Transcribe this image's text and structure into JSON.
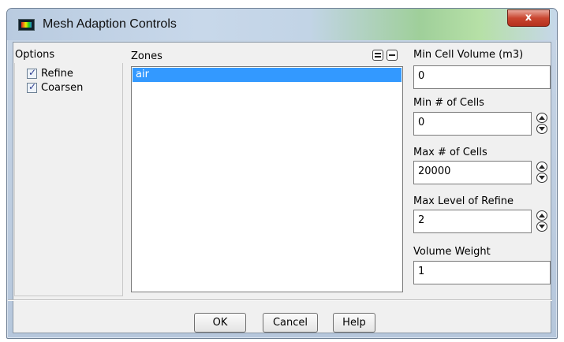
{
  "window": {
    "title": "Mesh Adaption Controls",
    "close_label": "x"
  },
  "options": {
    "label": "Options",
    "items": [
      {
        "label": "Refine",
        "checked": true
      },
      {
        "label": "Coarsen",
        "checked": true
      }
    ]
  },
  "zones": {
    "label": "Zones",
    "items": [
      {
        "label": "air",
        "selected": true
      }
    ],
    "select_all_icon": "select-all-icon",
    "deselect_all_icon": "deselect-all-icon"
  },
  "fields": {
    "min_cell_volume": {
      "label": "Min Cell Volume (m3)",
      "value": "0"
    },
    "min_cells": {
      "label": "Min # of Cells",
      "value": "0"
    },
    "max_cells": {
      "label": "Max # of Cells",
      "value": "20000"
    },
    "max_level_refine": {
      "label": "Max Level of Refine",
      "value": "2"
    },
    "volume_weight": {
      "label": "Volume Weight",
      "value": "1"
    }
  },
  "buttons": {
    "ok": "OK",
    "cancel": "Cancel",
    "help": "Help"
  },
  "colors": {
    "selection": "#3399ff",
    "close_button": "#c94630"
  }
}
